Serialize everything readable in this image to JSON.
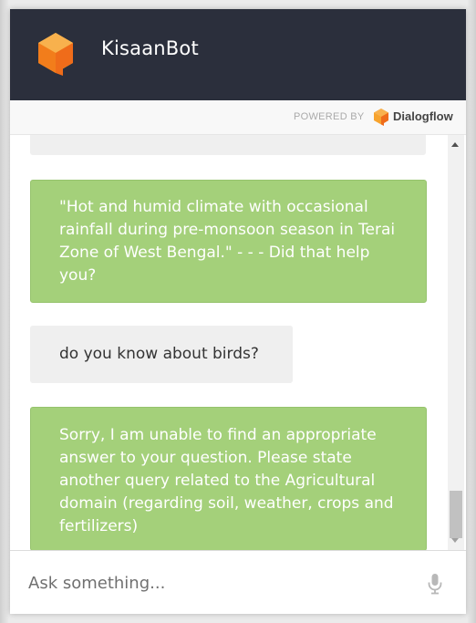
{
  "header": {
    "title": "KisaanBot",
    "logo_icon": "dialogflow-cube-icon",
    "background_color": "#2b2f3c",
    "accent_color": "#f27d1b"
  },
  "powered_by": {
    "label": "POWERED BY",
    "brand": "Dialogflow",
    "brand_icon": "dialogflow-logo-icon"
  },
  "messages": [
    {
      "sender": "user",
      "text": ""
    },
    {
      "sender": "bot",
      "text": "\"Hot and humid climate with occasional rainfall during pre-monsoon season in Terai Zone of West Bengal.\" - - - Did that help you?"
    },
    {
      "sender": "user",
      "text": "do you know about birds?"
    },
    {
      "sender": "bot",
      "text": "Sorry, I am unable to find an appropriate answer to your question. Please state another query related to the Agricultural domain (regarding soil, weather, crops and fertilizers)"
    }
  ],
  "bubble_colors": {
    "bot": "#a4d07a",
    "user": "#efefef"
  },
  "input": {
    "placeholder": "Ask something...",
    "value": "",
    "mic_icon": "microphone-icon"
  }
}
